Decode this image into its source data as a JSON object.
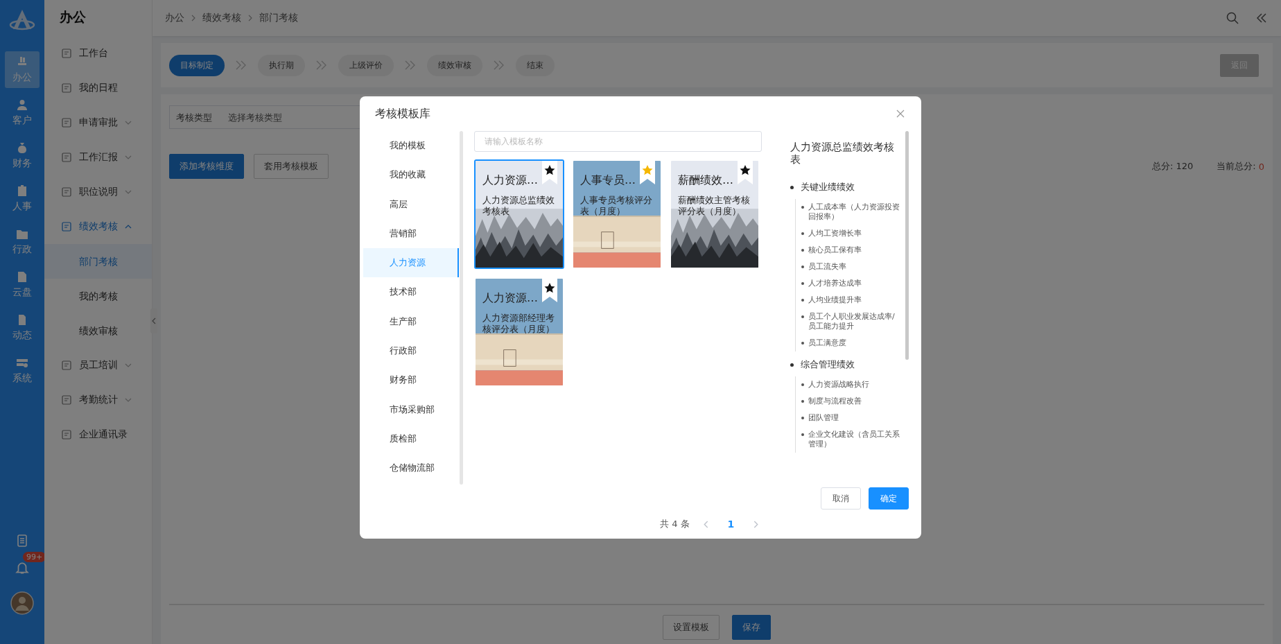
{
  "rail": {
    "items": [
      {
        "label": "办公",
        "selected": true
      },
      {
        "label": "客户",
        "selected": false
      },
      {
        "label": "财务",
        "selected": false
      },
      {
        "label": "人事",
        "selected": false
      },
      {
        "label": "行政",
        "selected": false
      },
      {
        "label": "云盘",
        "selected": false
      },
      {
        "label": "动态",
        "selected": false
      },
      {
        "label": "系统",
        "selected": false
      }
    ],
    "badge": "99+"
  },
  "sidebar": {
    "title": "办公",
    "items": [
      {
        "label": "工作台"
      },
      {
        "label": "我的日程"
      },
      {
        "label": "申请审批",
        "expanded": false
      },
      {
        "label": "工作汇报",
        "expanded": false
      },
      {
        "label": "职位说明",
        "expanded": false
      },
      {
        "label": "绩效考核",
        "expanded": true,
        "children": [
          {
            "label": "部门考核",
            "selected": true
          },
          {
            "label": "我的考核",
            "selected": false
          },
          {
            "label": "绩效审核",
            "selected": false
          }
        ]
      },
      {
        "label": "员工培训",
        "expanded": false
      },
      {
        "label": "考勤统计",
        "expanded": false
      },
      {
        "label": "企业通讯录"
      }
    ]
  },
  "breadcrumb": [
    "办公",
    "绩效考核",
    "部门考核"
  ],
  "steps": [
    {
      "label": "目标制定",
      "selected": true
    },
    {
      "label": "执行期",
      "selected": false
    },
    {
      "label": "上级评价",
      "selected": false
    },
    {
      "label": "绩效审核",
      "selected": false
    },
    {
      "label": "结束",
      "selected": false
    }
  ],
  "return_button": "返回",
  "filter": {
    "label": "考核类型",
    "placeholder": "选择考核类型"
  },
  "actions": [
    {
      "label": "添加考核维度",
      "kind": "primary"
    },
    {
      "label": "套用考核模板",
      "kind": "default"
    }
  ],
  "totals": {
    "total_label": "总分:",
    "total": "120",
    "current_label": "当前总分:",
    "current": "0"
  },
  "footer_buttons": [
    {
      "label": "设置模板",
      "kind": "default"
    },
    {
      "label": "保存",
      "kind": "primary"
    }
  ],
  "dialog": {
    "title": "考核模板库",
    "categories": [
      {
        "label": "我的模板",
        "selected": false
      },
      {
        "label": "我的收藏",
        "selected": false
      },
      {
        "label": "高层",
        "selected": false
      },
      {
        "label": "营销部",
        "selected": false
      },
      {
        "label": "人力资源",
        "selected": true
      },
      {
        "label": "技术部",
        "selected": false
      },
      {
        "label": "生产部",
        "selected": false
      },
      {
        "label": "行政部",
        "selected": false
      },
      {
        "label": "财务部",
        "selected": false
      },
      {
        "label": "市场采购部",
        "selected": false
      },
      {
        "label": "质检部",
        "selected": false
      },
      {
        "label": "仓储物流部",
        "selected": false
      }
    ],
    "search": {
      "placeholder": "请输入模板名称"
    },
    "cards": [
      {
        "title": "人力资源…",
        "description": "人力资源总监绩效考核表",
        "favorited": false,
        "selected": true,
        "kind": "forest"
      },
      {
        "title": "人事专员…",
        "description": "人事专员考核评分表（月度）",
        "favorited": true,
        "selected": false,
        "kind": "wall"
      },
      {
        "title": "薪酬绩效…",
        "description": "薪酬绩效主管考核评分表（月度）",
        "favorited": false,
        "selected": false,
        "kind": "forest"
      },
      {
        "title": "人力资源…",
        "description": "人力资源部经理考核评分表（月度）",
        "favorited": false,
        "selected": false,
        "kind": "wall"
      }
    ],
    "preview": {
      "title": "人力资源总监绩效考核表",
      "groups": [
        {
          "label": "关键业绩绩效",
          "children": [
            "人工成本率（人力资源投资回报率）",
            "人均工资增长率",
            "核心员工保有率",
            "员工流失率",
            "人才培养达成率",
            "人均业绩提升率",
            "员工个人职业发展达成率/员工能力提升",
            "员工满意度"
          ]
        },
        {
          "label": "综合管理绩效",
          "children": [
            "人力资源战略执行",
            "制度与流程改善",
            "团队管理",
            "企业文化建设（含员工关系管理）"
          ]
        }
      ]
    },
    "pagination": {
      "total": "共 4 条",
      "pages": [
        {
          "label": "1",
          "selected": true
        }
      ]
    },
    "buttons": [
      {
        "label": "取消",
        "kind": "default"
      },
      {
        "label": "确定",
        "kind": "primary"
      }
    ]
  }
}
